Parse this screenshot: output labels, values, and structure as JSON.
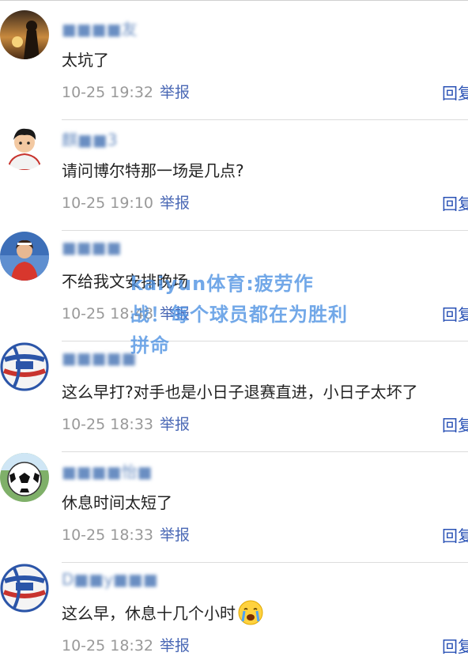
{
  "report_label": "举报",
  "reply_label": "回复",
  "comments": [
    {
      "username": "■■■■友",
      "username_clear": "友",
      "text": "太坑了",
      "time": "10-25 19:32"
    },
    {
      "username": "麒■■3",
      "username_clear": "",
      "text": "请问博尔特那一场是几点?",
      "time": "10-25 19:10"
    },
    {
      "username": "■■■■",
      "username_clear": "",
      "text": "不给我文安排晚场",
      "time": "10-25 18:48"
    },
    {
      "username": "■■■■■",
      "username_clear": "",
      "text": "这么早打?对手也是小日子退赛直进，小日子太坏了",
      "time": "10-25 18:33"
    },
    {
      "username": "■■■■怡■",
      "username_clear": "",
      "text": "休息时间太短了",
      "time": "10-25 18:33"
    },
    {
      "username": "D■■y■■■",
      "username_clear": "",
      "text": "这么早，休息十几个小时",
      "time": "10-25 18:32"
    }
  ],
  "watermark": "kaiyun体育:疲劳作战！每个球员都在为胜利拼命"
}
